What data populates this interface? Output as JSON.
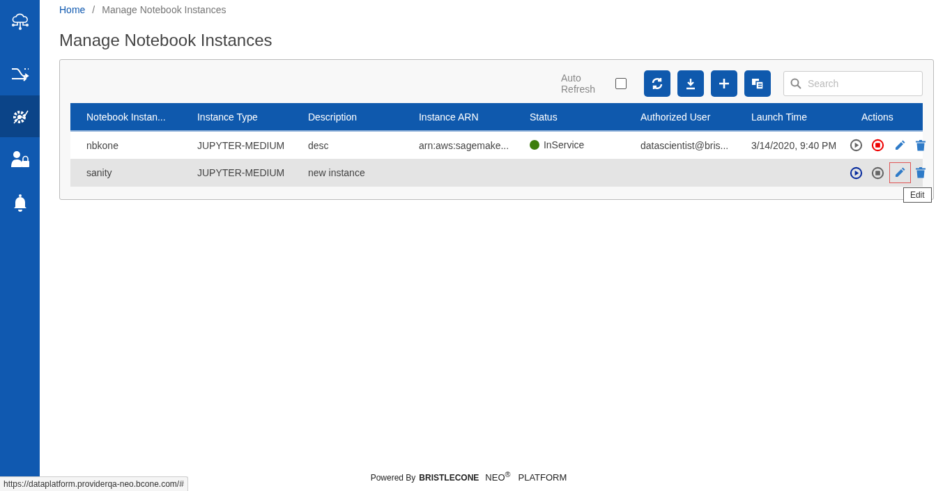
{
  "sidebar": {
    "items": [
      {
        "kind": "cloud",
        "selected": false
      },
      {
        "kind": "shuffle",
        "selected": false
      },
      {
        "kind": "gear",
        "selected": true
      },
      {
        "kind": "user-lock",
        "selected": false
      },
      {
        "kind": "bell",
        "selected": false
      }
    ]
  },
  "breadcrumb": [
    "Home",
    "/",
    "Manage Notebook Instances"
  ],
  "title": "Manage Notebook Instances",
  "toolbar": {
    "auto_refresh_label": "Auto Refresh",
    "auto_refresh_checked": false,
    "search": {
      "placeholder": "Search"
    }
  },
  "table": {
    "columns": [
      "Notebook Instan...",
      "Instance Type",
      "Description",
      "Instance ARN",
      "Status",
      "Authorized User",
      "Launch Time",
      "Actions"
    ],
    "rows": [
      {
        "cells": [
          "nbkone",
          "JUPYTER-MEDIUM",
          "desc",
          "arn:aws:sagemake...",
          "InService",
          "datascientist@bris...",
          "3/14/2020, 9:40 PM"
        ],
        "color": "#3d7d0a",
        "highlighted": false,
        "start_enabled": false,
        "stop_enabled": true,
        "edit_focused": false
      },
      {
        "cells": [
          "sanity",
          "JUPYTER-MEDIUM",
          "new instance",
          "",
          "",
          "",
          ""
        ],
        "highlighted": true,
        "start_enabled": true,
        "stop_enabled": false,
        "edit_focused": true
      }
    ]
  },
  "tooltip": "Edit",
  "footer": {
    "powered_by": "Powered By",
    "brand": "BRISTLECONE",
    "product": "NEO$^{®}$",
    "platform": "PLATFORM"
  },
  "status_bar": "https://dataplatform.providerqa-neo.bcone.com/#"
}
